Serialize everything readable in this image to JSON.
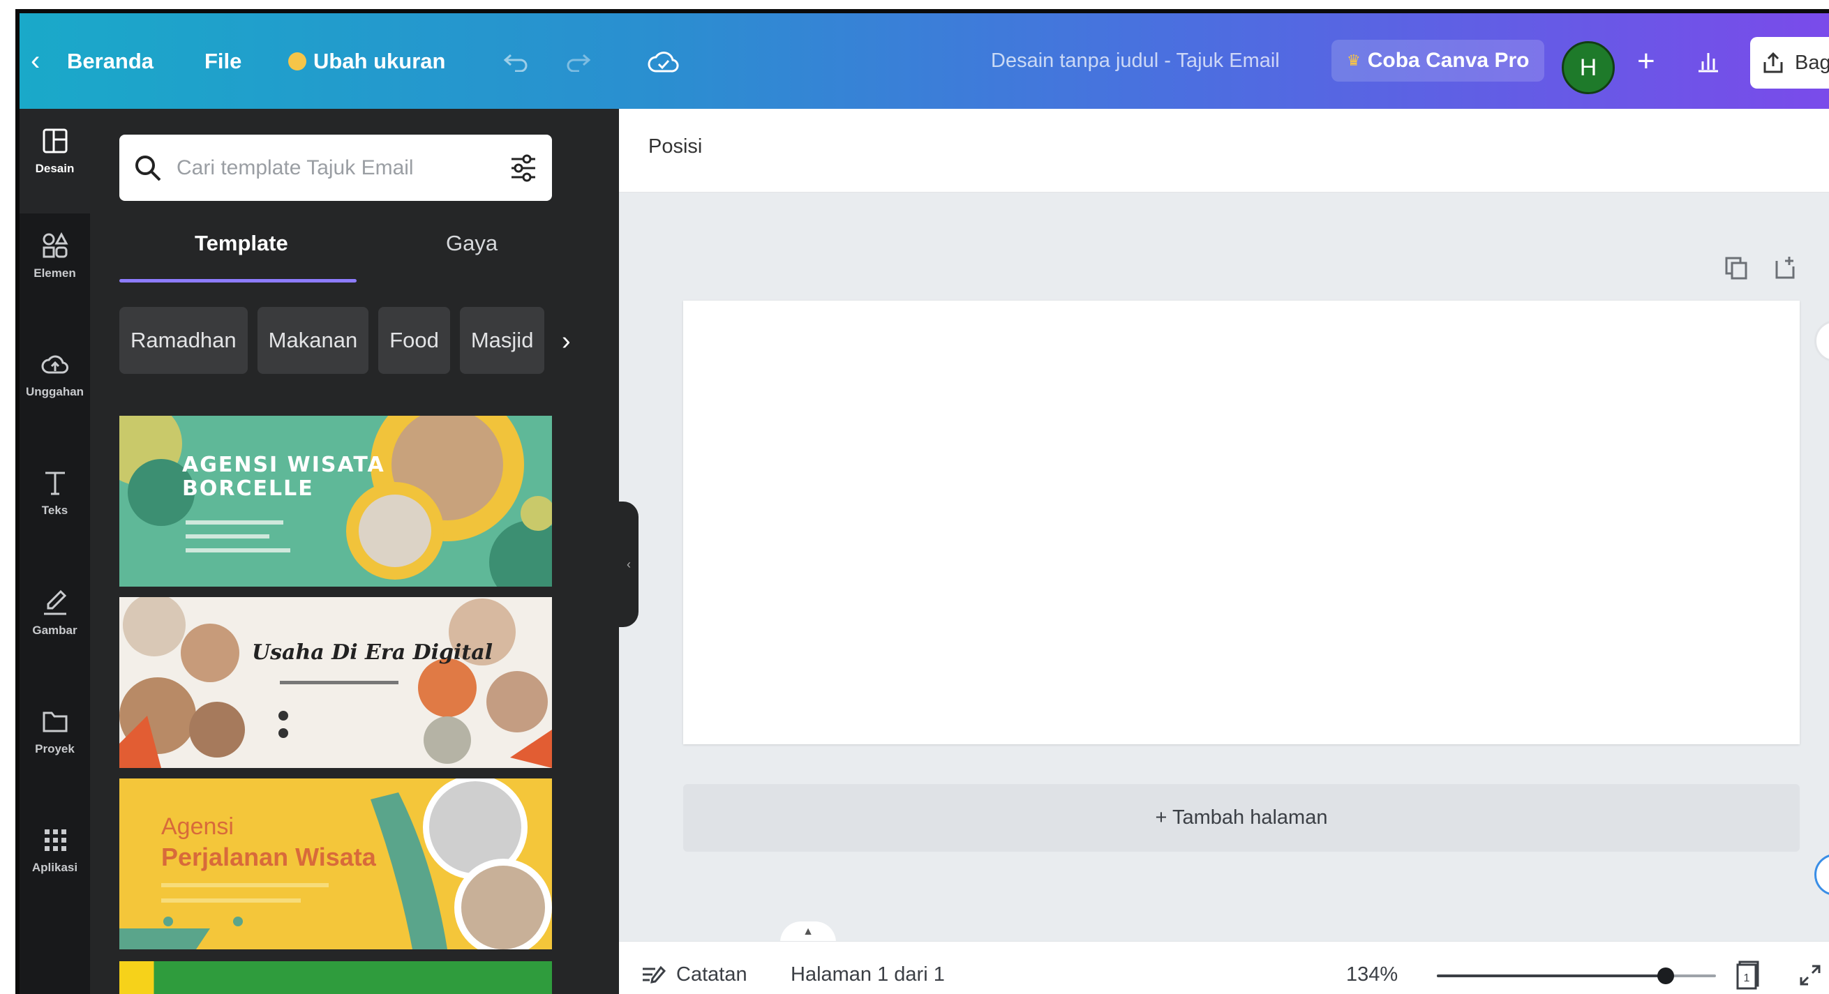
{
  "topbar": {
    "home": "Beranda",
    "file": "File",
    "resize": "Ubah ukuran",
    "doc_title": "Desain tanpa judul - Tajuk Email",
    "pro": "Coba Canva Pro",
    "avatar_initial": "H",
    "share": "Bag"
  },
  "rail": {
    "items": [
      {
        "label": "Desain",
        "icon": "layout-icon"
      },
      {
        "label": "Elemen",
        "icon": "shapes-icon"
      },
      {
        "label": "Unggahan",
        "icon": "cloud-upload-icon"
      },
      {
        "label": "Teks",
        "icon": "text-icon"
      },
      {
        "label": "Gambar",
        "icon": "draw-icon"
      },
      {
        "label": "Proyek",
        "icon": "folder-icon"
      },
      {
        "label": "Aplikasi",
        "icon": "apps-grid-icon"
      }
    ]
  },
  "panel": {
    "search_placeholder": "Cari template Tajuk Email",
    "tabs": {
      "template": "Template",
      "style": "Gaya"
    },
    "chips": [
      "Ramadhan",
      "Makanan",
      "Food",
      "Masjid"
    ],
    "cards": {
      "card1": {
        "line1": "AGENSI WISATA",
        "line2": "BORCELLE"
      },
      "card2": {
        "title": "Usaha Di Era Digital"
      },
      "card3": {
        "line1": "Agensi",
        "line2": "Perjalanan Wisata"
      }
    }
  },
  "canvas": {
    "position_label": "Posisi",
    "add_page": "+ Tambah halaman"
  },
  "bottombar": {
    "notes": "Catatan",
    "page_info": "Halaman 1 dari 1",
    "zoom": "134%",
    "zoom_slider_fraction": 0.82,
    "page_count": "1"
  },
  "colors": {
    "topbar_start": "#1aa9c9",
    "topbar_end": "#7a4bea",
    "panel_bg": "#252627",
    "rail_bg": "#18191b",
    "accent": "#8d7cff"
  }
}
